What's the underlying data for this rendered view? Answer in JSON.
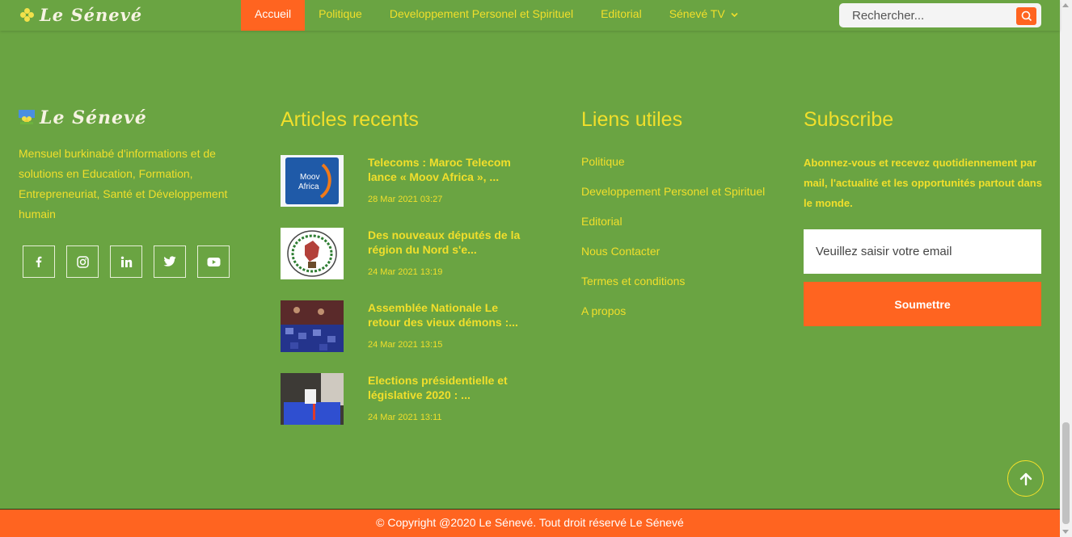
{
  "brand": {
    "name": "Le Sénevé",
    "description": "Mensuel burkinabé d'informations et de solutions en Education, Formation, Entrepreneuriat, Santé et Développement humain"
  },
  "nav": {
    "items": [
      {
        "label": "Accueil",
        "active": true
      },
      {
        "label": "Politique",
        "active": false
      },
      {
        "label": "Developpement Personel et Spirituel",
        "active": false
      },
      {
        "label": "Editorial",
        "active": false
      },
      {
        "label": "Sénevé TV",
        "active": false,
        "has_dropdown": true
      }
    ],
    "search_placeholder": "Rechercher..."
  },
  "socials": [
    {
      "icon": "facebook-icon"
    },
    {
      "icon": "instagram-icon"
    },
    {
      "icon": "linkedin-icon"
    },
    {
      "icon": "twitter-icon"
    },
    {
      "icon": "youtube-icon"
    }
  ],
  "articles": {
    "title": "Articles recents",
    "items": [
      {
        "title": "Telecoms : Maroc Telecom lance « Moov Africa », ...",
        "date": "28 Mar 2021 03:27",
        "thumb": "moov-africa-logo"
      },
      {
        "title": "Des nouveaux députés de la région du Nord s'e...",
        "date": "24 Mar 2021 13:19",
        "thumb": "assembly-emblem"
      },
      {
        "title": "Assemblée Nationale Le retour des vieux démons :...",
        "date": "24 Mar 2021 13:15",
        "thumb": "assembly-hall-photo"
      },
      {
        "title": "Elections présidentielle et législative 2020 : ...",
        "date": "24 Mar 2021 13:11",
        "thumb": "ballot-box-photo"
      }
    ]
  },
  "links": {
    "title": "Liens utiles",
    "items": [
      "Politique",
      "Developpement Personel et Spirituel",
      "Editorial",
      "Nous Contacter",
      "Termes et conditions",
      "A propos"
    ]
  },
  "subscribe": {
    "title": "Subscribe",
    "description": "Abonnez-vous et recevez quotidiennement par mail, l'actualité et les opportunités partout dans le monde.",
    "email_placeholder": "Veuillez saisir votre email",
    "button_label": "Soumettre"
  },
  "copyright": "© Copyright @2020 Le Sénevé. Tout droit réservé Le Sénevé",
  "colors": {
    "background": "#6aa442",
    "accent": "#ff6420",
    "text_yellow": "#f1df2b"
  }
}
